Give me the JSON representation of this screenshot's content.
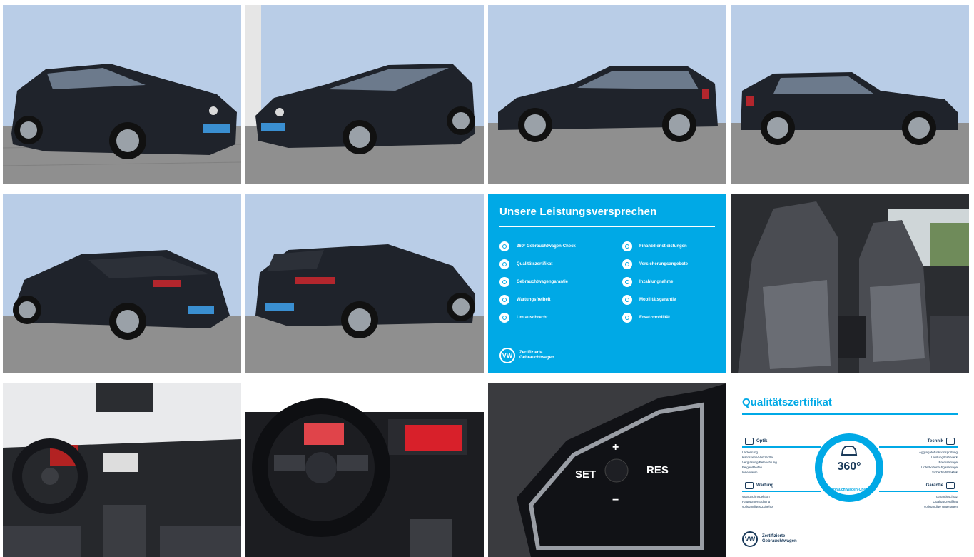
{
  "gallery": {
    "photos": [
      {
        "name": "photo-front-left-34",
        "view": "front-left"
      },
      {
        "name": "photo-front-right-34",
        "view": "front-right"
      },
      {
        "name": "photo-side-left",
        "view": "side-left"
      },
      {
        "name": "photo-side-right",
        "view": "side-right"
      },
      {
        "name": "photo-rear-left-34",
        "view": "rear-left"
      },
      {
        "name": "photo-rear-right-34",
        "view": "rear-right"
      },
      {
        "name": "photo-seats",
        "view": "seats"
      },
      {
        "name": "photo-dashboard",
        "view": "dashboard"
      },
      {
        "name": "photo-steering-wheel",
        "view": "steering"
      },
      {
        "name": "photo-wheel-buttons",
        "view": "buttons"
      }
    ],
    "colors": {
      "paint": "#1f232b",
      "wall": "#b9cde7",
      "ground": "#8f8f8f",
      "vw_blue": "#00a9e6"
    }
  },
  "promise_card": {
    "title": "Unsere Leistungsversprechen",
    "left_items": [
      "360° Gebrauchtwagen-Check",
      "Qualitätszertifikat",
      "Gebrauchtwagengarantie",
      "Wartungsfreiheit",
      "Umtauschrecht"
    ],
    "right_items": [
      "Finanzdienstleistungen",
      "Versicherungsangebote",
      "Inzahlungnahme",
      "Mobilitätsgarantie",
      "Ersatzmobilität"
    ],
    "footer": "Zertifizierte Gebrauchtwagen",
    "logo": "VW"
  },
  "quality_card": {
    "title": "Qualitätszertifikat",
    "center_number": "360°",
    "ring_text": "Gebrauchtwagen-Check",
    "sections": {
      "optik": {
        "title": "Optik",
        "items": [
          "Lackierung",
          "Karosserie/Verkratzte",
          "Verglasung/Beleuchtung",
          "Felgen/Reifen",
          "Innenraum"
        ]
      },
      "technik": {
        "title": "Technik",
        "items": [
          "Aggregatefunktionsprüfung",
          "Leistung/Fahrwerk",
          "Bremsanlage",
          "Unterboden/Abgasanlage",
          "Sicherheit/Elektrik"
        ]
      },
      "wartung": {
        "title": "Wartung",
        "items": [
          "Wartung/Inspektion",
          "Hauptuntersuchung",
          "vollständiges Zubehör"
        ]
      },
      "garantie": {
        "title": "Garantie",
        "items": [
          "Garantieschutz",
          "Qualitätszertifikat",
          "vollständige Unterlagen"
        ]
      }
    },
    "footer": "Zertifizierte Gebrauchtwagen",
    "logo": "VW"
  },
  "wheel_buttons": {
    "set": "SET",
    "res": "RES",
    "plus": "+",
    "minus": "−"
  }
}
